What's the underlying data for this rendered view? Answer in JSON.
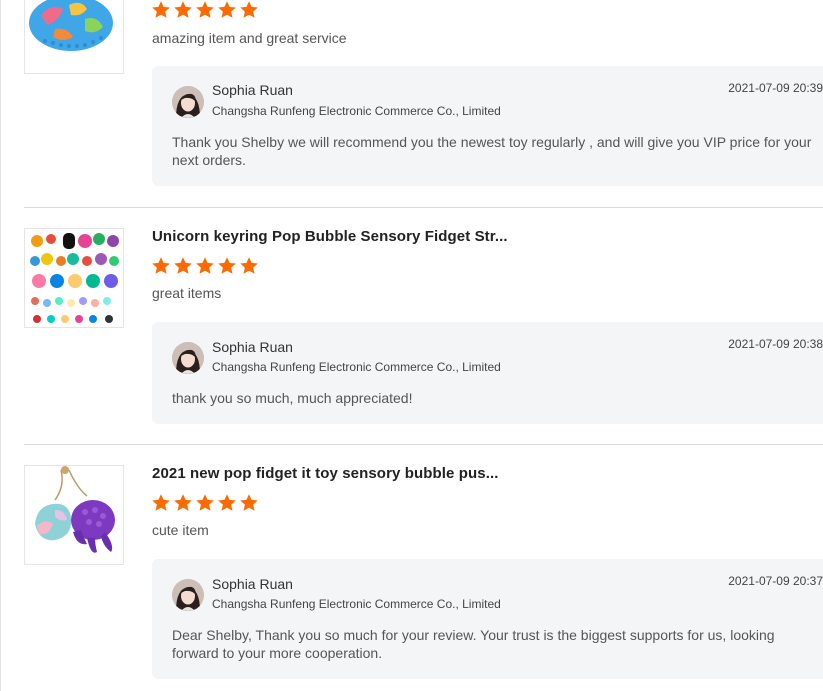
{
  "reviews": [
    {
      "product_title": "",
      "rating": 5,
      "comment": "amazing item and great service",
      "reply": {
        "seller_name": "Sophia Ruan",
        "company": "Changsha Runfeng Electronic Commerce Co., Limited",
        "date": "2021-07-09 20:39",
        "text": "Thank you Shelby we will recommend you the  newest toy regularly  , and will give you VIP price for your next orders."
      }
    },
    {
      "product_title": "Unicorn keyring Pop Bubble Sensory Fidget Str...",
      "rating": 5,
      "comment": "great items",
      "reply": {
        "seller_name": "Sophia Ruan",
        "company": "Changsha Runfeng Electronic Commerce Co., Limited",
        "date": "2021-07-09 20:38",
        "text": "thank you so much, much appreciated!"
      }
    },
    {
      "product_title": "2021 new pop fidget it toy sensory bubble pus...",
      "rating": 5,
      "comment": "cute item",
      "reply": {
        "seller_name": "Sophia Ruan",
        "company": "Changsha Runfeng Electronic Commerce Co., Limited",
        "date": "2021-07-09 20:37",
        "text": "Dear Shelby, Thank you so much for your review. Your trust is the biggest  supports for us, looking forward to your more cooperation."
      }
    }
  ],
  "colors": {
    "star": "#ff6a00",
    "reply_background": "#f4f5f7",
    "divider": "#d9d9d9"
  },
  "icons": {
    "star": "star-icon",
    "avatar": "seller-avatar"
  }
}
